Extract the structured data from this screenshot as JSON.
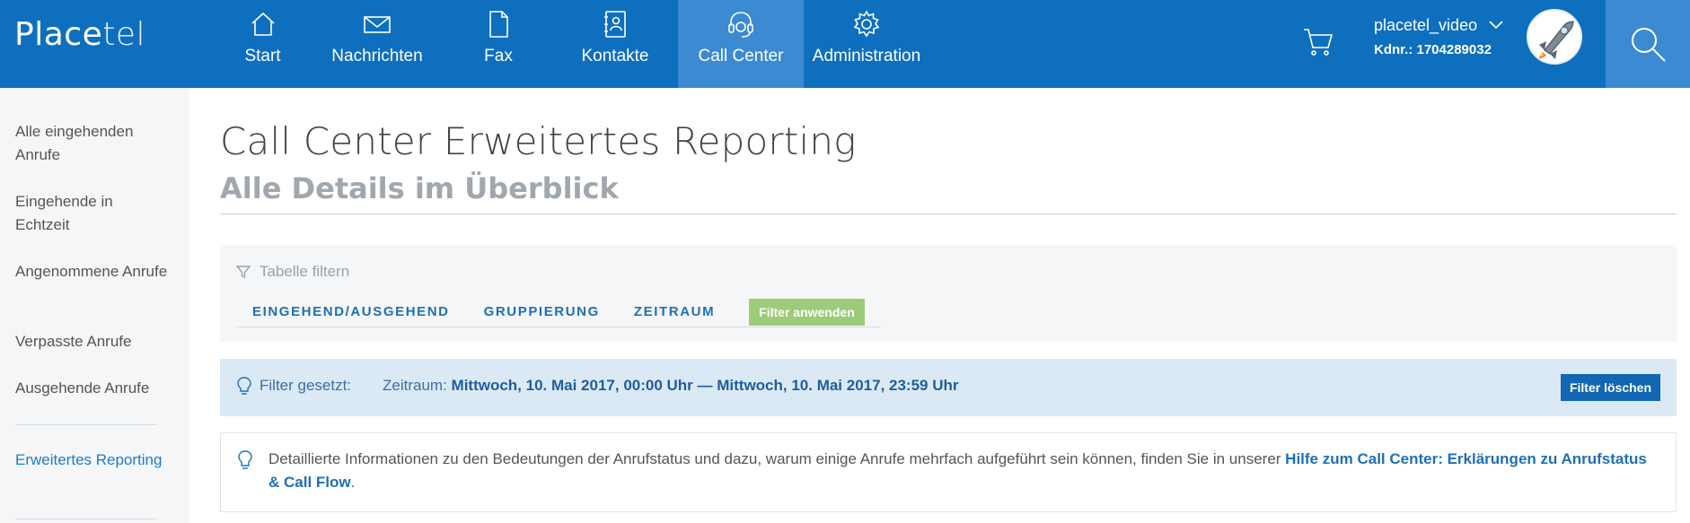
{
  "brand": {
    "name_bold": "Place",
    "name_thin": "tel"
  },
  "nav": [
    {
      "label": "Start",
      "icon": "house-icon"
    },
    {
      "label": "Nachrichten",
      "icon": "envelope-icon"
    },
    {
      "label": "Fax",
      "icon": "document-icon"
    },
    {
      "label": "Kontakte",
      "icon": "contacts-book-icon"
    },
    {
      "label": "Call Center",
      "icon": "headset-icon",
      "active": true
    },
    {
      "label": "Administration",
      "icon": "gear-icon"
    }
  ],
  "account": {
    "name": "placetel_video",
    "customer_number": "Kdnr.: 1704289032"
  },
  "sidebar": {
    "items": [
      {
        "label": "Alle eingehenden Anrufe"
      },
      {
        "label": "Eingehende in Echtzeit"
      },
      {
        "label": "Angenommene Anrufe"
      },
      {
        "label": "Verpasste Anrufe"
      },
      {
        "label": "Ausgehende Anrufe"
      },
      {
        "label": "Erweitertes Reporting",
        "active": true
      }
    ]
  },
  "page": {
    "title": "Call Center Erweitertes Reporting",
    "subtitle": "Alle Details im Überblick"
  },
  "filter": {
    "heading": "Tabelle filtern",
    "tabs": [
      "EINGEHEND/AUSGEHEND",
      "GRUPPIERUNG",
      "ZEITRAUM"
    ],
    "apply_label": "Filter anwenden"
  },
  "filter_set": {
    "label": "Filter gesetzt:",
    "value_prefix": "Zeitraum:",
    "value": "Mittwoch, 10. Mai 2017, 00:00 Uhr — Mittwoch, 10. Mai 2017, 23:59 Uhr",
    "clear_label": "Filter löschen"
  },
  "info": {
    "text": "Detaillierte Informationen zu den Bedeutungen der Anrufstatus und dazu, warum einige Anrufe mehrfach aufgeführt sein können, finden Sie in unserer ",
    "link_text": "Hilfe zum Call Center: Erklärungen zu Anrufstatus & Call Flow",
    "suffix": "."
  },
  "colors": {
    "topbar": "#0f6fbf",
    "active_nav": "#3b8ad2",
    "apply_button": "#9ccb7a",
    "clear_button": "#1167b3",
    "filter_set_bg": "#dbe9f5"
  }
}
